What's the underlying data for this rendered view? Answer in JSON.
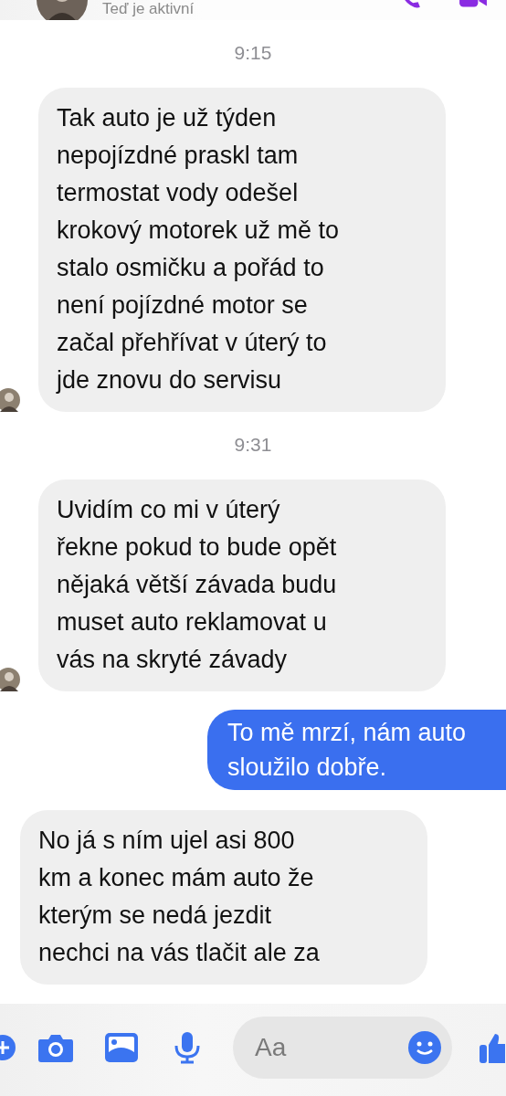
{
  "header": {
    "status": "Teď je aktivní"
  },
  "messages": [
    {
      "kind": "time",
      "text": "9:15"
    },
    {
      "kind": "received",
      "avatar": true,
      "text": "Tak auto je už týden\nnepojízdné praskl tam\ntermostat vody odešel\nkrokový motorek už mě to\nstalo osmičku a pořád to\nnení pojízdné motor se\nzačal přehřívat v úterý to\njde znovu do servisu"
    },
    {
      "kind": "time",
      "text": "9:31"
    },
    {
      "kind": "received",
      "avatar": true,
      "text": "Uvidím co mi v úterý\nřekne pokud to bude opět\nnějaká větší závada budu\nmuset auto reklamovat u\nvás na skryté závady"
    },
    {
      "kind": "sent",
      "text": "To mě mrzí, nám auto\nsloužilo dobře."
    },
    {
      "kind": "received",
      "avatar": false,
      "text": "No já s ním ujel asi 800\nkm a konec mám auto že\nkterým se nedá jezdit\nnechci na vás tlačit ale za"
    }
  ],
  "composer": {
    "placeholder": "Aa"
  }
}
